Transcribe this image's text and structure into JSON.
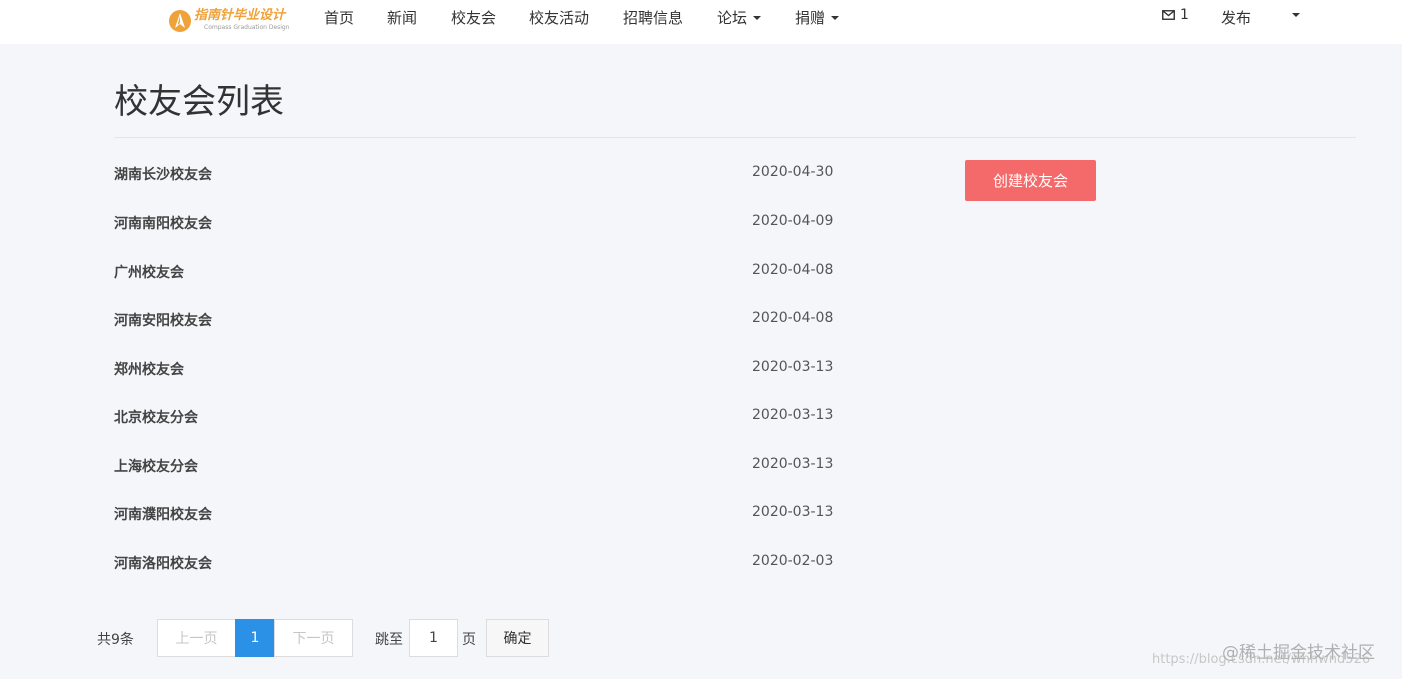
{
  "header": {
    "logo_text": "指南针毕业设计",
    "logo_subtext": "Compass Graduation Design",
    "nav": [
      {
        "label": "首页"
      },
      {
        "label": "新闻"
      },
      {
        "label": "校友会"
      },
      {
        "label": "校友活动"
      },
      {
        "label": "招聘信息"
      },
      {
        "label": "论坛",
        "dropdown": true
      },
      {
        "label": "捐赠",
        "dropdown": true
      }
    ],
    "mail_count": "1",
    "publish_label": "发布"
  },
  "page": {
    "title": "校友会列表",
    "create_button_label": "创建校友会"
  },
  "associations": [
    {
      "name": "湖南长沙校友会",
      "date": "2020-04-30"
    },
    {
      "name": "河南南阳校友会",
      "date": "2020-04-09"
    },
    {
      "name": "广州校友会",
      "date": "2020-04-08"
    },
    {
      "name": "河南安阳校友会",
      "date": "2020-04-08"
    },
    {
      "name": "郑州校友会",
      "date": "2020-03-13"
    },
    {
      "name": "北京校友分会",
      "date": "2020-03-13"
    },
    {
      "name": "上海校友分会",
      "date": "2020-03-13"
    },
    {
      "name": "河南濮阳校友会",
      "date": "2020-03-13"
    },
    {
      "name": "河南洛阳校友会",
      "date": "2020-02-03"
    }
  ],
  "pagination": {
    "total_text": "共9条",
    "prev_label": "上一页",
    "current_page": "1",
    "next_label": "下一页",
    "jump_label": "跳至",
    "jump_value": "1",
    "page_unit": "页",
    "confirm_label": "确定"
  },
  "watermark": {
    "line1": "@稀土掘金技术社区",
    "line2": "https://blog.csdn.net/whhwnd526"
  },
  "colors": {
    "accent_red": "#f46a6a",
    "pagination_active": "#2b91e6",
    "logo_orange": "#f0a23a",
    "background": "#f5f6fa"
  },
  "icons": [
    "logo-compass-icon",
    "mail-icon",
    "caret-down-icon"
  ]
}
